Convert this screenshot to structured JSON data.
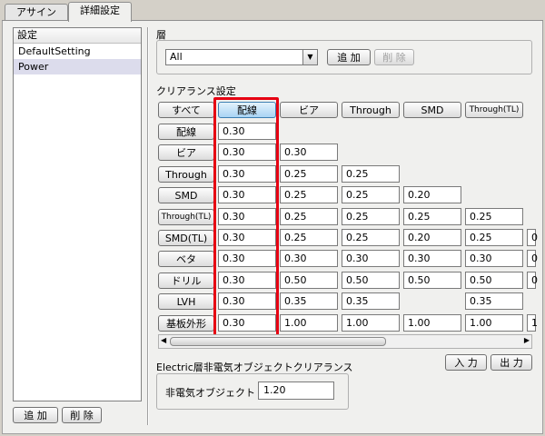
{
  "tabs": [
    "アサイン",
    "詳細設定"
  ],
  "left_panel": {
    "header": "設定",
    "items": [
      "DefaultSetting",
      "Power"
    ],
    "add_label": "追 加",
    "delete_label": "削 除"
  },
  "layer": {
    "title": "層",
    "select_value": "All",
    "add_label": "追 加",
    "delete_label": "削 除"
  },
  "clearance": {
    "title": "クリアランス設定",
    "all_label": "すべて",
    "columns": [
      "配線",
      "ビア",
      "Through",
      "SMD",
      "Through(TL)"
    ],
    "rows": [
      {
        "label": "配線",
        "values": [
          "0.30"
        ]
      },
      {
        "label": "ビア",
        "values": [
          "0.30",
          "0.30"
        ]
      },
      {
        "label": "Through",
        "values": [
          "0.30",
          "0.25",
          "0.25"
        ]
      },
      {
        "label": "SMD",
        "values": [
          "0.30",
          "0.25",
          "0.25",
          "0.20"
        ]
      },
      {
        "label": "Through(TL)",
        "values": [
          "0.30",
          "0.25",
          "0.25",
          "0.25",
          "0.25"
        ]
      },
      {
        "label": "SMD(TL)",
        "values": [
          "0.30",
          "0.25",
          "0.25",
          "0.20",
          "0.25",
          "0"
        ]
      },
      {
        "label": "ベタ",
        "values": [
          "0.30",
          "0.30",
          "0.30",
          "0.30",
          "0.30",
          "0"
        ]
      },
      {
        "label": "ドリル",
        "values": [
          "0.30",
          "0.50",
          "0.50",
          "0.50",
          "0.50",
          "0"
        ]
      },
      {
        "label": "LVH",
        "values": [
          "0.30",
          "0.35",
          "0.35",
          "",
          "0.35",
          ""
        ]
      },
      {
        "label": "基板外形",
        "values": [
          "0.30",
          "1.00",
          "1.00",
          "1.00",
          "1.00",
          "1"
        ]
      }
    ],
    "input_label": "入 力",
    "output_label": "出 力"
  },
  "electric": {
    "title": "Electric層非電気オブジェクトクリアランス",
    "label": "非電気オブジェクト",
    "value": "1.20"
  },
  "colors": {
    "highlight": "#e60012",
    "selected_item": "#dcdcec"
  }
}
